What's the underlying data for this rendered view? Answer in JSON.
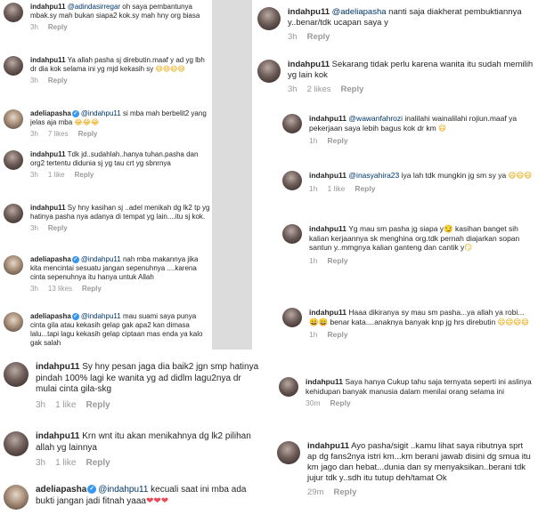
{
  "comments": [
    {
      "user": "indahpu11",
      "mention": "@adindasirregar",
      "text": " oh saya pembantunya mbak.sy mah bukan siapa2 kok.sy mah hny org biasa",
      "emoji": "",
      "time": "3h",
      "likes": "",
      "reply": "Reply"
    },
    {
      "user": "indahpu11",
      "mention": "",
      "text": "Ya allah pasha sj direbutin.maaf y ad yg lbh dr dia kok selama ini yg mjd kekasih sy ",
      "emoji": "😄😄😄😄",
      "time": "3h",
      "likes": "",
      "reply": "Reply"
    },
    {
      "user": "adeliapasha",
      "mention": "@indahpu11",
      "text": " si mba mah berbelit2 yang jelas aja mba ",
      "emoji": "😂😂😂",
      "time": "3h",
      "likes": "7 likes",
      "reply": "Reply"
    },
    {
      "user": "indahpu11",
      "mention": "",
      "text": "Tdk jd..sudahlah..hanya tuhan.pasha dan org2 tertentu didunia sj yg tau crt yg sbnrnya",
      "emoji": "",
      "time": "3h",
      "likes": "1 like",
      "reply": "Reply"
    },
    {
      "user": "indahpu11",
      "mention": "",
      "text": "Sy hny kasihan sj ..adel menikah dg lk2 tp yg hatinya pasha nya adanya di tempat yg lain....itu sj kok.",
      "emoji": "",
      "time": "3h",
      "likes": "",
      "reply": "Reply"
    },
    {
      "user": "adeliapasha",
      "mention": "@indahpu11",
      "text": " nah mba makannya jika kita mencintai sesuatu jangan sepenuhnya ....karena cinta sepenuhnya itu hanya untuk Allah",
      "emoji": "",
      "time": "3h",
      "likes": "13 likes",
      "reply": "Reply"
    },
    {
      "user": "adeliapasha",
      "mention": "@indahpu11",
      "text": " mau suami saya punya cinta gila atau kekasih gelap gak apa2 kan dimasa lalu...tapi lagu kekasih gelap ciptaan mas enda ya kalo gak salah",
      "emoji": "",
      "time": "",
      "likes": "",
      "reply": ""
    },
    {
      "user": "indahpu11",
      "mention": "",
      "text": "Sy hny pesan jaga dia baik2 jgn smp hatinya pindah 100% lagi ke wanita yg ad didlm lagu2nya dr mulai cinta gila-skg",
      "emoji": "",
      "time": "3h",
      "likes": "1 like",
      "reply": "Reply"
    },
    {
      "user": "indahpu11",
      "mention": "",
      "text": "Krn wnt itu akan menikahnya dg lk2 pilihan allah yg lainnya",
      "emoji": "",
      "time": "3h",
      "likes": "1 like",
      "reply": "Reply"
    },
    {
      "user": "adeliapasha",
      "mention": "@indahpu11",
      "text": " kecuali saat ini mba ada bukti jangan jadi fitnah yaaa",
      "emoji": "❤❤❤",
      "time": "",
      "likes": "",
      "reply": ""
    },
    {
      "user": "indahpu11",
      "mention": "@adeliapasha",
      "text": " nanti saja diakherat pembuktiannya y..benar/tdk ucapan saya y",
      "emoji": "",
      "time": "3h",
      "likes": "",
      "reply": "Reply"
    },
    {
      "user": "indahpu11",
      "mention": "",
      "text": "Sekarang tidak perlu karena wanita itu sudah memilih yg lain kok",
      "emoji": "",
      "time": "3h",
      "likes": "2 likes",
      "reply": "Reply"
    },
    {
      "user": "indahpu11",
      "mention": "@wawanfahrozi",
      "text": " inalilahi wainalilahi rojiun.maaf ya pekerjaan saya lebih bagus kok dr km ",
      "emoji": "😄",
      "time": "1h",
      "likes": "",
      "reply": "Reply"
    },
    {
      "user": "indahpu11",
      "mention": "@inasyahira23",
      "text": " iya lah tdk mungkin jg sm sy ya",
      "emoji": "😄😄😄",
      "time": "1h",
      "likes": "1 like",
      "reply": "Reply"
    },
    {
      "user": "indahpu11",
      "mention": "",
      "text": "Yg mau sm pasha jg siapa y😏 kasihan banget sih kalian kerjaannya sk menghina org.tdk pernah diajarkan sopan santun y..mmgnya kalian ganteng dan cantik y",
      "emoji": "😏",
      "time": "1h",
      "likes": "",
      "reply": "Reply"
    },
    {
      "user": "indahpu11",
      "mention": "",
      "text": "Haaa dikiranya sy mau sm pasha...ya allah ya robi...😄😄 benar kata....anaknya banyak knp jg hrs direbutin ",
      "emoji": "😄😄😄😄",
      "time": "1h",
      "likes": "",
      "reply": "Reply"
    },
    {
      "user": "indahpu11",
      "mention": "",
      "text": "Saya hanya Cukup tahu saja ternyata seperti ini aslinya kehidupan banyak manusia dalam menilai orang selama ini",
      "emoji": "",
      "time": "30m",
      "likes": "",
      "reply": "Reply"
    },
    {
      "user": "indahpu11",
      "mention": "",
      "text": "Ayo pasha/sigit ..kamu lihat saya ributnya sprt ap dg fans2nya istri km...km berani jawab disini dg smua itu km jago dan hebat...dunia dan sy menyaksikan..berani tdk jujur tdk y..sdh itu tutup deh/tamat Ok",
      "emoji": "",
      "time": "29m",
      "likes": "",
      "reply": "Reply"
    }
  ]
}
